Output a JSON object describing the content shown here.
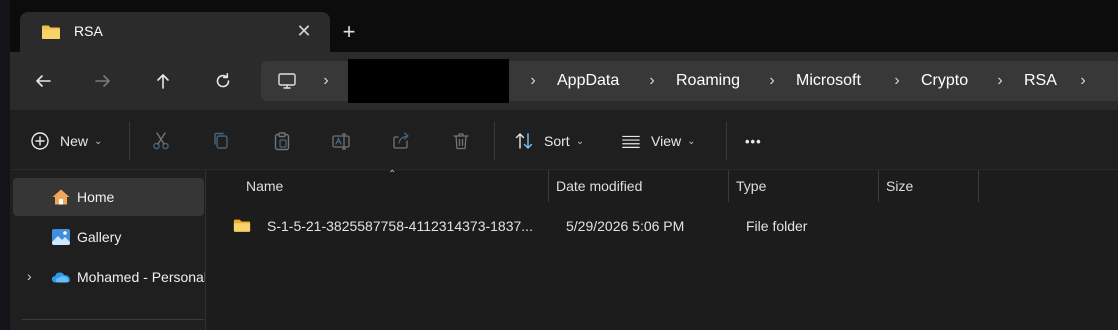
{
  "tab": {
    "title": "RSA",
    "close_icon": "close-icon",
    "new_tab_icon": "plus-icon"
  },
  "nav": {
    "back_icon": "arrow-left-icon",
    "forward_icon": "arrow-right-icon",
    "up_icon": "arrow-up-icon",
    "refresh_icon": "refresh-icon"
  },
  "address": {
    "root_icon": "monitor-icon",
    "crumbs": [
      "AppData",
      "Roaming",
      "Microsoft",
      "Crypto",
      "RSA"
    ]
  },
  "toolbar": {
    "new_label": "New",
    "sort_label": "Sort",
    "view_label": "View",
    "more_label": "•••"
  },
  "sidebar": {
    "items": [
      {
        "label": "Home",
        "icon": "home-icon",
        "selected": true
      },
      {
        "label": "Gallery",
        "icon": "gallery-icon",
        "selected": false
      },
      {
        "label": "Mohamed - Personal",
        "icon": "onedrive-cloud-icon",
        "selected": false
      }
    ]
  },
  "columns": [
    "Name",
    "Date modified",
    "Type",
    "Size"
  ],
  "files": [
    {
      "name": "S-1-5-21-3825587758-4112314373-1837...",
      "date": "5/29/2026 5:06 PM",
      "type": "File folder",
      "size": ""
    }
  ],
  "colors": {
    "folder": "#f3c14b",
    "accent": "#4aa3f0"
  }
}
